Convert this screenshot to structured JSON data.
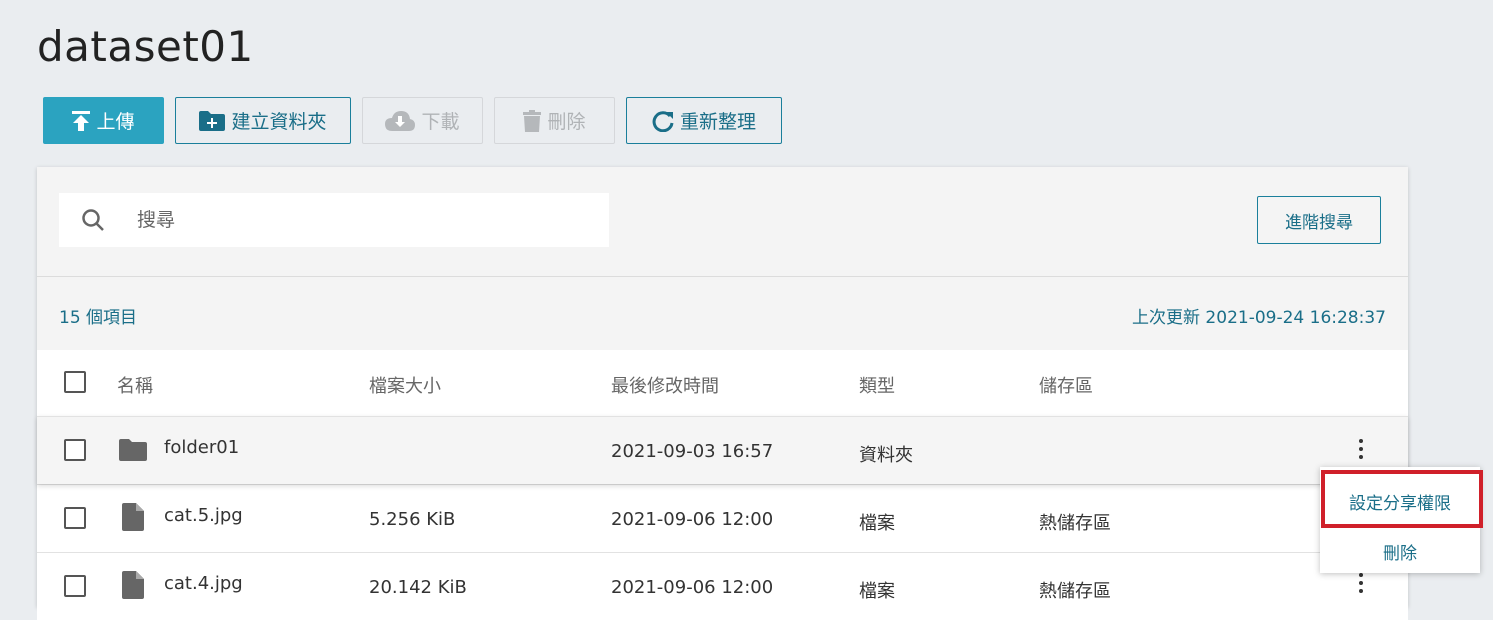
{
  "page": {
    "title": "dataset01"
  },
  "toolbar": {
    "upload": "上傳",
    "new_folder": "建立資料夾",
    "download": "下載",
    "delete": "刪除",
    "refresh": "重新整理"
  },
  "search": {
    "placeholder": "搜尋",
    "advanced": "進階搜尋"
  },
  "summary": {
    "count": "15 個項目",
    "updated": "上次更新 2021-09-24 16:28:37"
  },
  "table": {
    "headers": {
      "name": "名稱",
      "size": "檔案大小",
      "modified": "最後修改時間",
      "type": "類型",
      "storage": "儲存區"
    },
    "rows": [
      {
        "name": "folder01",
        "size": "",
        "modified": "2021-09-03 16:57",
        "type": "資料夾",
        "storage": ""
      },
      {
        "name": "cat.5.jpg",
        "size": "5.256 KiB",
        "modified": "2021-09-06 12:00",
        "type": "檔案",
        "storage": "熱儲存區"
      },
      {
        "name": "cat.4.jpg",
        "size": "20.142 KiB",
        "modified": "2021-09-06 12:00",
        "type": "檔案",
        "storage": "熱儲存區"
      }
    ]
  },
  "context_menu": {
    "share": "設定分享權限",
    "delete": "刪除"
  },
  "colors": {
    "accent": "#2ba3c0",
    "link": "#1a6e88",
    "highlight": "#d0202a"
  }
}
